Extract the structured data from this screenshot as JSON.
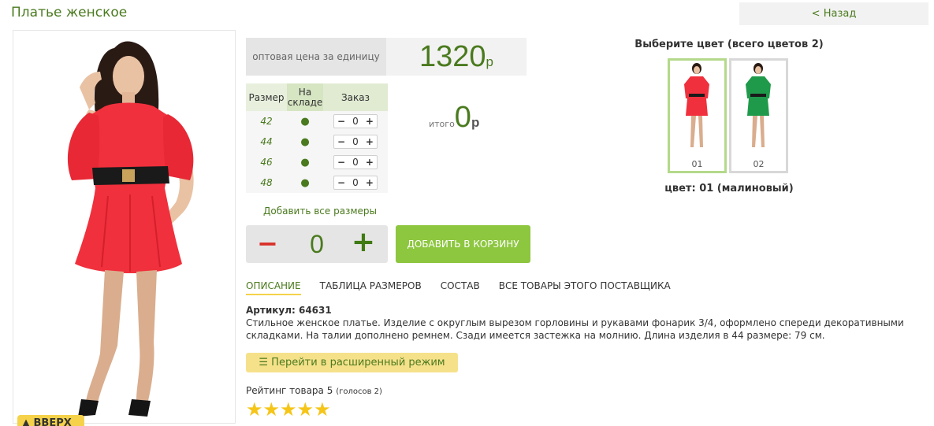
{
  "header": {
    "title": "Платье женское",
    "back_label": "< Назад"
  },
  "photo": {
    "up_label": "▲ ВВЕРХ"
  },
  "price": {
    "label": "оптовая цена за единицу",
    "value": "1320",
    "currency": "р"
  },
  "sizes": {
    "headers": [
      "Размер",
      "На складе",
      "Заказ"
    ],
    "rows": [
      {
        "size": "42",
        "stock": "●",
        "qty": "0"
      },
      {
        "size": "44",
        "stock": "●",
        "qty": "0"
      },
      {
        "size": "46",
        "stock": "●",
        "qty": "0"
      },
      {
        "size": "48",
        "stock": "●",
        "qty": "0"
      }
    ]
  },
  "total": {
    "label": "итого",
    "value": "0",
    "currency": "р"
  },
  "add_all_label": "Добавить все размеры",
  "quantity": {
    "minus": "−",
    "value": "0",
    "plus": "+"
  },
  "cart_label": "ДОБАВИТЬ В КОРЗИНУ",
  "tabs": [
    "ОПИСАНИЕ",
    "ТАБЛИЦА РАЗМЕРОВ",
    "СОСТАВ",
    "ВСЕ ТОВАРЫ ЭТОГО ПОСТАВЩИКА"
  ],
  "article": "Артикул: 64631",
  "description": "Стильное женское платье. Изделие с округлым вырезом горловины и рукавами фонарик 3/4, оформлено спереди декоративными складками. На талии дополнено ремнем. Сзади имеется застежка на молнию. Длина изделия в 44 размере: 79 см.",
  "extended_label": "Перейти в расширенный режим",
  "rating": {
    "label": "Рейтинг товара 5",
    "votes": "(голосов 2)",
    "stars": 5,
    "max": 5
  },
  "colors": {
    "title": "Выберите цвет (всего цветов 2)",
    "swatches": [
      {
        "number": "01",
        "dress_color": "#f0303c"
      },
      {
        "number": "02",
        "dress_color": "#1f9a4a"
      }
    ],
    "selected_label": "цвет: 01 (малиновый)"
  },
  "theme": {
    "accent_green": "#4a7a1e",
    "button_green": "#8dc63f",
    "yellow": "#f5d24a",
    "minus_red": "#d9322b"
  }
}
